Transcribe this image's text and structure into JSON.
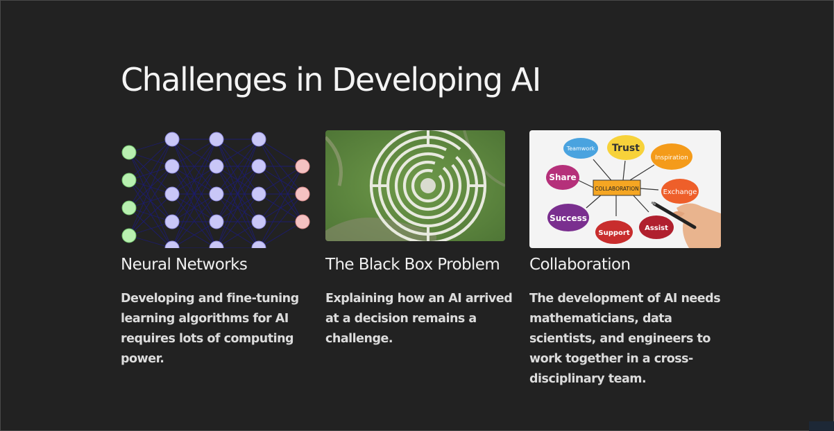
{
  "slide": {
    "title": "Challenges in Developing AI"
  },
  "cards": [
    {
      "heading": "Neural Networks",
      "text": "Developing and fine-tuning learning algorithms for AI requires lots of computing power.",
      "image": "neural-network-diagram"
    },
    {
      "heading": "The Black Box Problem",
      "text": "Explaining how an AI arrived at a decision remains a challenge.",
      "image": "labyrinth-aerial-photo"
    },
    {
      "heading": "Collaboration",
      "text": "The development of AI needs mathematicians, data scientists, and engineers to work together in a cross-disciplinary team.",
      "image": "collaboration-mind-map"
    }
  ],
  "mindmap": {
    "center": "COLLABORATION",
    "words": [
      "Teamwork",
      "Trust",
      "Inspiration",
      "Share",
      "Exchange",
      "Success",
      "Support",
      "Assist"
    ]
  }
}
